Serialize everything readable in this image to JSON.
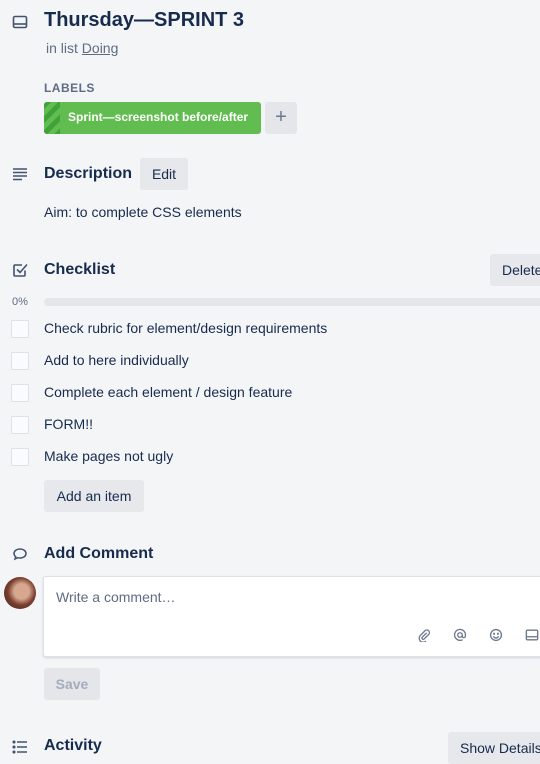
{
  "card": {
    "title": "Thursday—SPRINT 3",
    "list_prefix": "in list",
    "list_name": "Doing"
  },
  "labels": {
    "heading": "LABELS",
    "items": [
      {
        "text": "Sprint—screenshot before/after",
        "color": "#61bd4f"
      }
    ],
    "add_symbol": "+"
  },
  "description": {
    "title": "Description",
    "edit_label": "Edit",
    "text": "Aim: to complete CSS elements"
  },
  "checklist": {
    "title": "Checklist",
    "delete_label": "Delete",
    "progress_text": "0%",
    "progress_value": 0,
    "items": [
      {
        "text": "Check rubric for element/design requirements",
        "checked": false
      },
      {
        "text": "Add to here individually",
        "checked": false
      },
      {
        "text": "Complete each element / design feature",
        "checked": false
      },
      {
        "text": "FORM!!",
        "checked": false
      },
      {
        "text": "Make pages not ugly",
        "checked": false
      }
    ],
    "add_item_label": "Add an item"
  },
  "comment": {
    "title": "Add Comment",
    "placeholder": "Write a comment…",
    "save_label": "Save",
    "toolbar_icons": [
      "attachment-icon",
      "mention-icon",
      "emoji-icon",
      "card-icon"
    ]
  },
  "activity": {
    "title": "Activity",
    "show_details_label": "Show Details"
  },
  "colors": {
    "label_green": "#61bd4f",
    "text_primary": "#172b4d",
    "text_secondary": "#5e6c84",
    "button_bg": "#e6e8ec"
  }
}
